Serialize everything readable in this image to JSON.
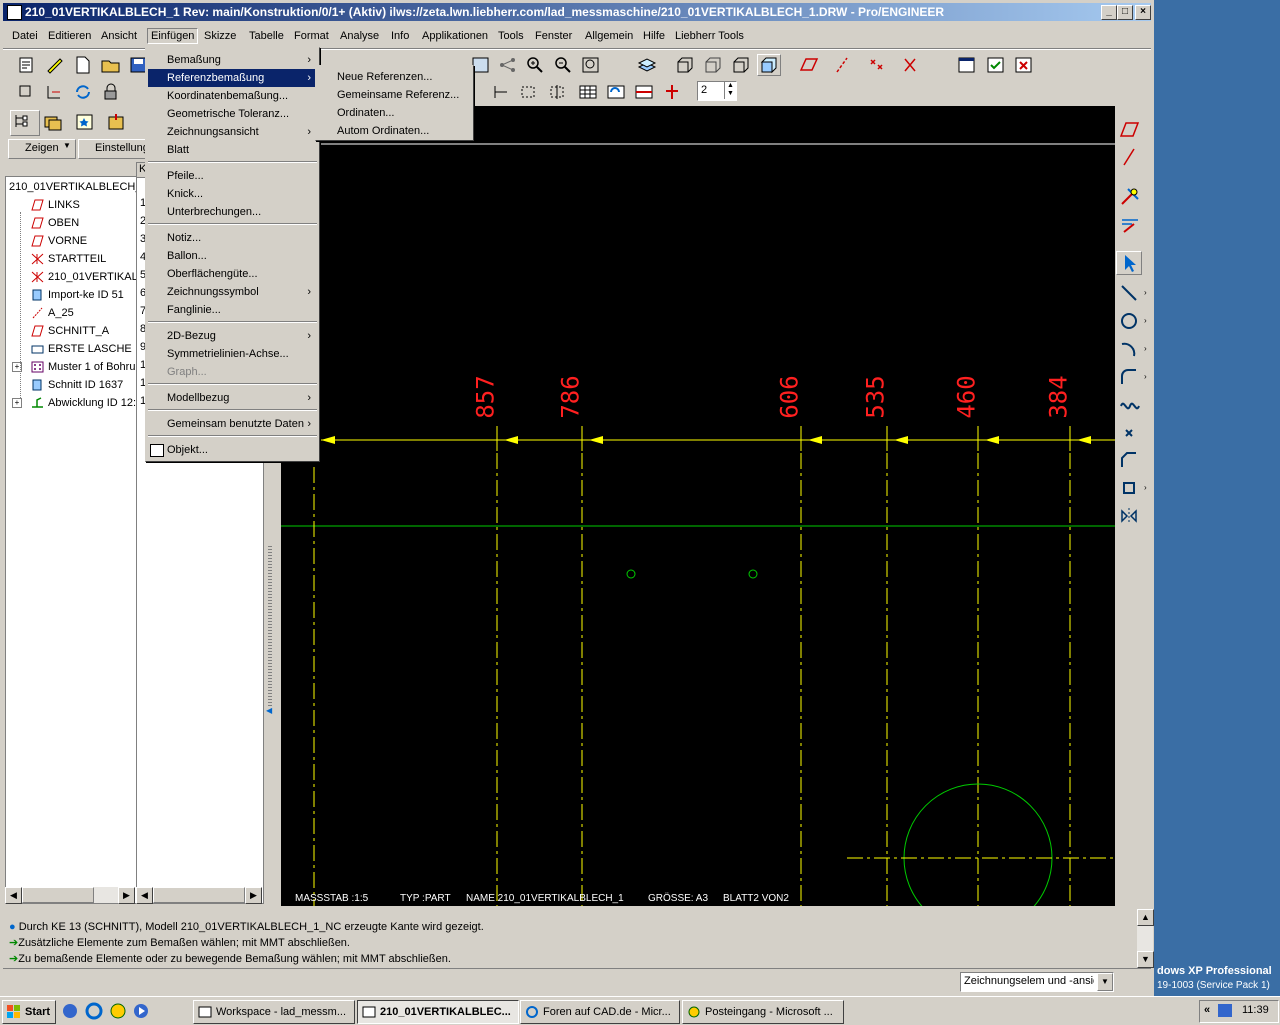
{
  "window": {
    "title": "210_01VERTIKALBLECH_1 Rev: main/Konstruktion/0/1+ (Aktiv) ilws://zeta.lwn.liebherr.com/lad_messmaschine/210_01VERTIKALBLECH_1.DRW - Pro/ENGINEER",
    "min": "_",
    "max": "□",
    "close": "×"
  },
  "menubar": [
    "Datei",
    "Editieren",
    "Ansicht",
    "Einfügen",
    "Skizze",
    "Tabelle",
    "Format",
    "Analyse",
    "Info",
    "Applikationen",
    "Tools",
    "Fenster",
    "Allgemein",
    "Hilfe",
    "Liebherr Tools"
  ],
  "nav": {
    "show_button": "Zeigen",
    "settings_button": "Einstellung",
    "col_header": "K",
    "root": "210_01VERTIKALBLECH_",
    "items": [
      {
        "label": "LINKS",
        "col": "1"
      },
      {
        "label": "OBEN",
        "col": "2"
      },
      {
        "label": "VORNE",
        "col": "3"
      },
      {
        "label": "STARTTEIL",
        "col": "4"
      },
      {
        "label": "210_01VERTIKAL",
        "col": "5"
      },
      {
        "label": "Import-ke ID 51",
        "col": "6"
      },
      {
        "label": "A_25",
        "col": "7"
      },
      {
        "label": "SCHNITT_A",
        "col": "8"
      },
      {
        "label": "ERSTE LASCHE",
        "col": "9"
      },
      {
        "label": "Muster 1 of Bohru",
        "col": "1"
      },
      {
        "label": "Schnitt ID 1637",
        "col": "1"
      },
      {
        "label": "Abwicklung ID 12:",
        "col": "1"
      }
    ]
  },
  "einfuegen_menu": [
    {
      "label": "Bemaßung",
      "sub": true
    },
    {
      "label": "Referenzbemaßung",
      "sub": true,
      "highlight": true
    },
    {
      "label": "Koordinatenbemaßung..."
    },
    {
      "label": "Geometrische Toleranz..."
    },
    {
      "label": "Zeichnungsansicht",
      "sub": true
    },
    {
      "label": "Blatt"
    },
    {
      "label": "Pfeile..."
    },
    {
      "label": "Knick..."
    },
    {
      "label": "Unterbrechungen..."
    },
    {
      "label": "Notiz..."
    },
    {
      "label": "Ballon..."
    },
    {
      "label": "Oberflächengüte..."
    },
    {
      "label": "Zeichnungssymbol",
      "sub": true
    },
    {
      "label": "Fanglinie..."
    },
    {
      "label": "2D-Bezug",
      "sub": true
    },
    {
      "label": "Symmetrielinien-Achse..."
    },
    {
      "label": "Graph...",
      "disabled": true
    },
    {
      "label": "Modellbezug",
      "sub": true
    },
    {
      "label": "Gemeinsam benutzte Daten",
      "sub": true
    },
    {
      "label": "Objekt..."
    }
  ],
  "ref_submenu": [
    "Neue Referenzen...",
    "Gemeinsame Referenz...",
    "Ordinaten...",
    "Autom Ordinaten..."
  ],
  "toolbar": {
    "spin_value": "2"
  },
  "drawing": {
    "dims": [
      "857",
      "786",
      "606",
      "535",
      "460",
      "384"
    ],
    "title_block": {
      "scale": "MASSSTAB :1:5",
      "type": "TYP :PART",
      "name": "NAME 210_01VERTIKALBLECH_1",
      "size": "GRÖSSE: A3",
      "sheet": "BLATT2  VON2"
    }
  },
  "messages": [
    "Durch KE 13 (SCHNITT), Modell 210_01VERTIKALBLECH_1_NC erzeugte Kante wird gezeigt.",
    "Zusätzliche Elemente zum Bemaßen wählen; mit MMT abschließen.",
    "Zu bemaßende Elemente oder zu bewegende Bemaßung wählen; mit MMT abschließen."
  ],
  "filter_select": "Zeichnungselem und -ansic",
  "desktop": {
    "line1": "dows XP Professional",
    "line2": "19-1003 (Service Pack 1)"
  },
  "taskbar": {
    "start": "Start",
    "tasks": [
      "Workspace - lad_messm...",
      "210_01VERTIKALBLEC...",
      "Foren auf CAD.de - Micr...",
      "Posteingang - Microsoft ..."
    ],
    "clock": "11:39",
    "chevron": "«"
  }
}
